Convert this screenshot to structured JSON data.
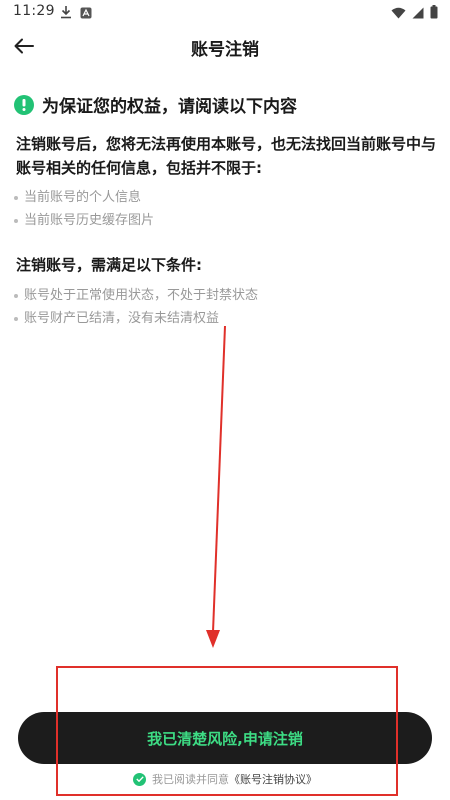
{
  "status_bar": {
    "time": "11:29",
    "left_icons": [
      "download-icon",
      "app-notification-icon"
    ],
    "right_icons": [
      "wifi-icon",
      "signal-icon",
      "battery-icon"
    ]
  },
  "header": {
    "back_icon": "back-arrow-icon",
    "title": "账号注销"
  },
  "notice": {
    "icon": "exclamation-icon",
    "icon_color": "#22c275",
    "text": "为保证您的权益，请阅读以下内容"
  },
  "intro": {
    "text": "注销账号后，您将无法再使用本账号，也无法找回当前账号中与账号相关的任何信息，包括并不限于:"
  },
  "lost_items": [
    {
      "label": "当前账号的个人信息"
    },
    {
      "label": "当前账号历史缓存图片"
    }
  ],
  "conditions": {
    "title": "注销账号，需满足以下条件:",
    "items": [
      {
        "label": "账号处于正常使用状态，不处于封禁状态"
      },
      {
        "label": "账号财产已结清，没有未结清权益"
      }
    ]
  },
  "footer": {
    "apply_label": "我已清楚风险,申请注销",
    "apply_text_color": "#3ddc84",
    "agree_prefix": "我已阅读并同意",
    "agree_link": "《账号注销协议》"
  },
  "annotation_color": "#e0302a"
}
